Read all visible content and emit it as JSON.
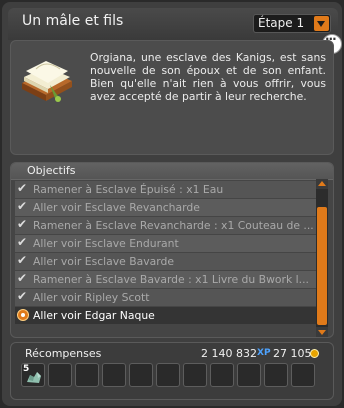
{
  "window": {
    "title": "Un mâle et fils",
    "step_select": "Étape 1"
  },
  "description": {
    "text": "Orgiana, une esclave des Kanigs, est sans nouvelle de son époux et de son enfant. Bien qu'elle n'ait rien à vous offrir, vous avez accepté de partir à leur recherche.",
    "icon": "quest-book-icon"
  },
  "objectives": {
    "header": "Objectifs",
    "items": [
      {
        "label": "Ramener à Esclave Épuisé : x1 Eau",
        "done": true
      },
      {
        "label": "Aller voir Esclave Revancharde",
        "done": true
      },
      {
        "label": "Ramener à Esclave Revancharde : x1 Couteau de ...",
        "done": true
      },
      {
        "label": "Aller voir Esclave Endurant",
        "done": true
      },
      {
        "label": "Aller voir Esclave Bavarde",
        "done": true
      },
      {
        "label": "Ramener à Esclave Bavarde : x1 Livre du Bwork l...",
        "done": true
      },
      {
        "label": "Aller voir Ripley Scott",
        "done": true
      },
      {
        "label": "Aller voir Edgar Naque",
        "done": false
      }
    ]
  },
  "rewards": {
    "title": "Récompenses",
    "xp": "2 140 832",
    "xp_icon": "XP",
    "kamas": "27 105",
    "kamas_icon": "kamas-icon",
    "item_quantity": "5",
    "item_icon": "stone-item-icon"
  },
  "colors": {
    "accent": "#e07a1a",
    "text": "#f0f0f0",
    "muted": "#a9a9a9"
  }
}
